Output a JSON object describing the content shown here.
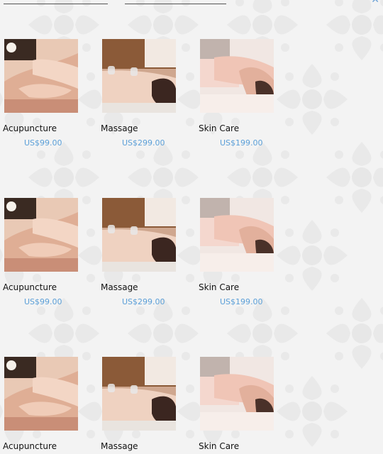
{
  "header": {
    "close_icon": "close-icon"
  },
  "products": [
    {
      "name": "Acupuncture",
      "price": "US$99.00",
      "image": "acupuncture-photo"
    },
    {
      "name": "Massage",
      "price": "US$299.00",
      "image": "massage-photo"
    },
    {
      "name": "Skin Care",
      "price": "US$199.00",
      "image": "skin-care-photo"
    },
    {
      "name": "Acupuncture",
      "price": "US$99.00",
      "image": "acupuncture-photo"
    },
    {
      "name": "Massage",
      "price": "US$299.00",
      "image": "massage-photo"
    },
    {
      "name": "Skin Care",
      "price": "US$199.00",
      "image": "skin-care-photo"
    },
    {
      "name": "Acupuncture",
      "price": "",
      "image": "acupuncture-photo"
    },
    {
      "name": "Massage",
      "price": "",
      "image": "massage-photo"
    },
    {
      "name": "Skin Care",
      "price": "",
      "image": "skin-care-photo"
    }
  ],
  "colors": {
    "price": "#5b9fd8",
    "background": "#f3f3f3"
  }
}
